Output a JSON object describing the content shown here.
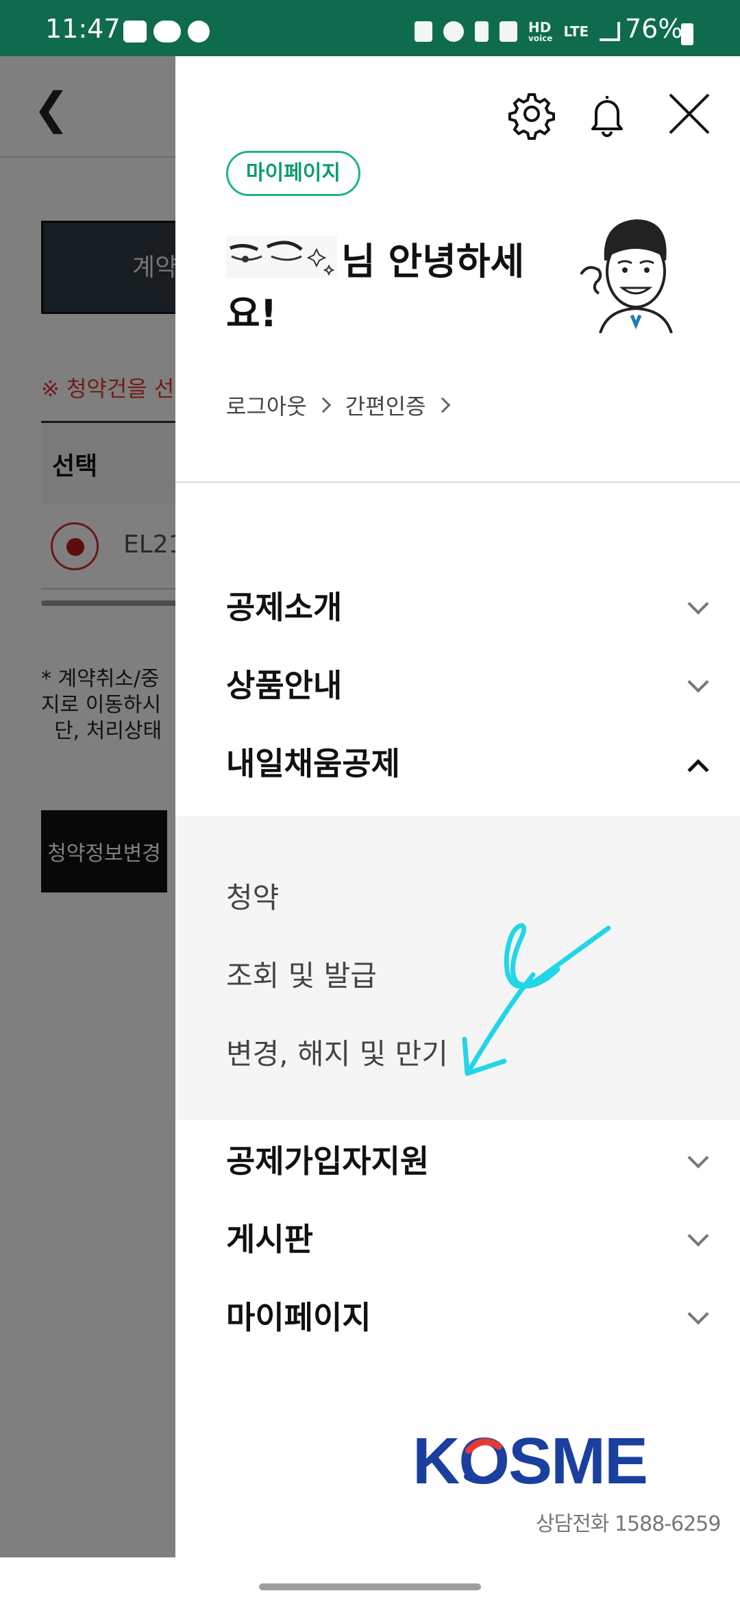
{
  "status_bar": {
    "time": "11:47",
    "network_hd": "HD",
    "network_voice": "voice",
    "network_lte": "LTE",
    "battery": "76%"
  },
  "background_page": {
    "dark_button_label": "계약",
    "notice": "※ 청약건을 선",
    "table_header": "선택",
    "row_text": "EL21",
    "footnote": "* 계약취소/중\n지로 이동하시\n  단, 처리상태",
    "change_button_label": "청약정보변경"
  },
  "drawer": {
    "icons": [
      "gear-icon",
      "bell-icon",
      "close-icon"
    ],
    "mypage_chip": "마이페이지",
    "greeting_text": "님 안녕하세요!",
    "auth_links": [
      "로그아웃",
      "간편인증"
    ],
    "menu": [
      {
        "label": "공제소개",
        "expanded": false
      },
      {
        "label": "상품안내",
        "expanded": false
      },
      {
        "label": "내일채움공제",
        "expanded": true
      },
      {
        "label": "공제가입자지원",
        "expanded": false
      },
      {
        "label": "게시판",
        "expanded": false
      },
      {
        "label": "마이페이지",
        "expanded": false
      }
    ],
    "submenu": [
      "청약",
      "조회 및 발급",
      "변경, 해지 및 만기"
    ],
    "logo_text": "KOSME",
    "hotline": "상담전화 1588-6259",
    "accent_color": "#1db584"
  }
}
